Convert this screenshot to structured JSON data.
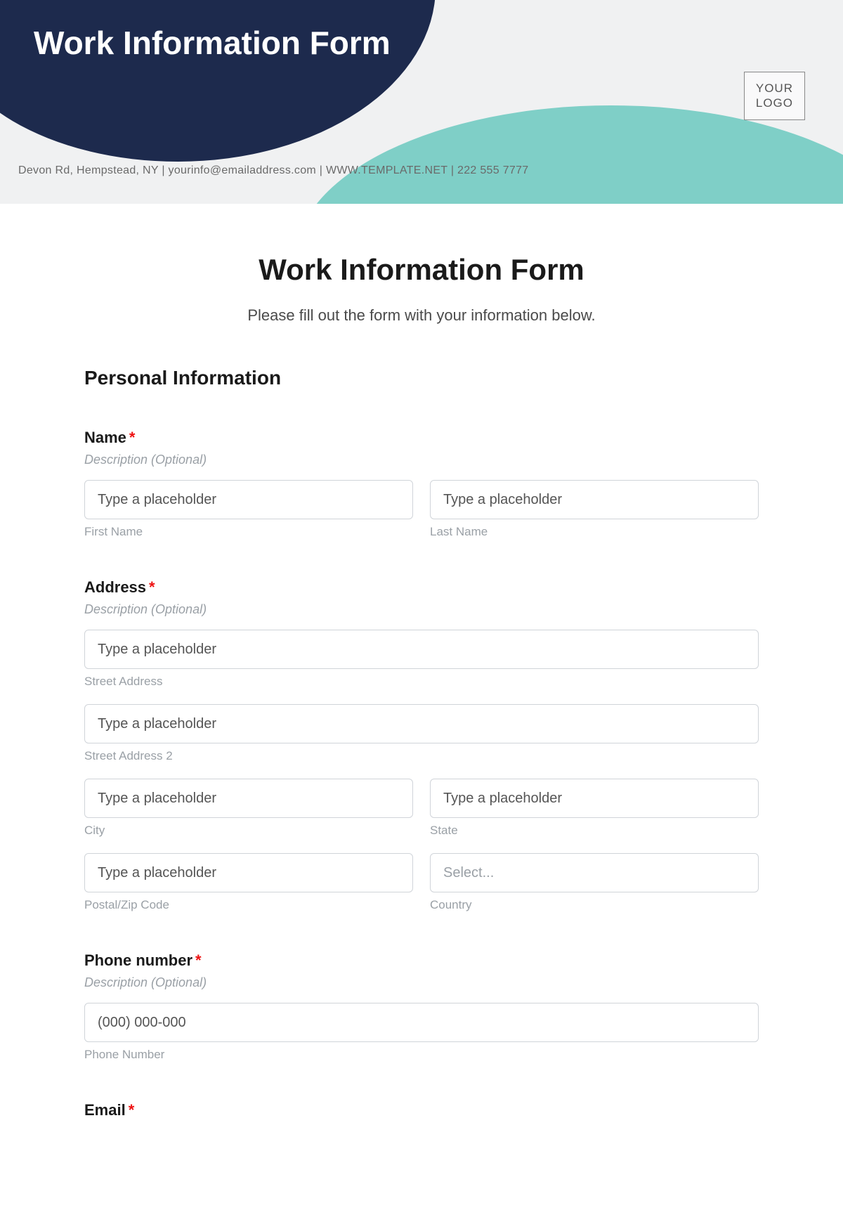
{
  "banner": {
    "title": "Work Information Form",
    "logo_line1": "YOUR",
    "logo_line2": "LOGO",
    "contact": "Devon Rd, Hempstead, NY | yourinfo@emailaddress.com | WWW.TEMPLATE.NET | 222 555 7777"
  },
  "form": {
    "heading": "Work Information Form",
    "subheading": "Please fill out the form with your information below.",
    "section_personal": "Personal Information",
    "required_mark": "*",
    "desc_placeholder": "Description (Optional)",
    "name": {
      "label": "Name",
      "first_placeholder": "Type a placeholder",
      "first_sub": "First Name",
      "last_placeholder": "Type a placeholder",
      "last_sub": "Last Name"
    },
    "address": {
      "label": "Address",
      "street1_placeholder": "Type a placeholder",
      "street1_sub": "Street Address",
      "street2_placeholder": "Type a placeholder",
      "street2_sub": "Street Address 2",
      "city_placeholder": "Type a placeholder",
      "city_sub": "City",
      "state_placeholder": "Type a placeholder",
      "state_sub": "State",
      "zip_placeholder": "Type a placeholder",
      "zip_sub": "Postal/Zip Code",
      "country_placeholder": "Select...",
      "country_sub": "Country"
    },
    "phone": {
      "label": "Phone number",
      "placeholder": "(000) 000-000",
      "sub": "Phone Number"
    },
    "email": {
      "label": "Email"
    }
  }
}
